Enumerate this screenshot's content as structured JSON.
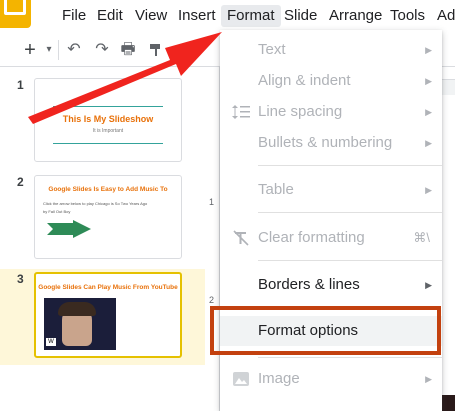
{
  "menubar": {
    "items": [
      "File",
      "Edit",
      "View",
      "Insert",
      "Format",
      "Slide",
      "Arrange",
      "Tools",
      "Ad"
    ],
    "active": "Format"
  },
  "toolbar": {
    "add": "+",
    "dropdown": "▾",
    "undo": "↶",
    "redo": "↷",
    "print": "🖶"
  },
  "filmstrip": {
    "slides": [
      {
        "number": "1",
        "title": "This Is My Slideshow",
        "subtitle": "It is Important"
      },
      {
        "number": "2",
        "title": "Google Slides Is Easy to Add Music To",
        "body1": "Click the arrow below to play Chicago is So Two Years Ago",
        "body2": "by Fall Out Boy"
      },
      {
        "number": "3",
        "title": "Google Slides Can Play Music From YouTube"
      }
    ]
  },
  "ruler": {
    "marks": [
      "1",
      "2"
    ]
  },
  "format_menu": {
    "items": [
      {
        "label": "Text",
        "enabled": false,
        "submenu": true
      },
      {
        "label": "Align & indent",
        "enabled": false,
        "submenu": true
      },
      {
        "label": "Line spacing",
        "enabled": false,
        "submenu": true,
        "icon": "line-spacing-icon"
      },
      {
        "label": "Bullets & numbering",
        "enabled": false,
        "submenu": true
      },
      {
        "label": "Table",
        "enabled": false,
        "submenu": true
      },
      {
        "label": "Clear formatting",
        "enabled": false,
        "shortcut": "⌘\\",
        "icon": "clear-formatting-icon"
      },
      {
        "label": "Borders & lines",
        "enabled": true,
        "submenu": true
      },
      {
        "label": "Format options",
        "enabled": true,
        "highlighted": true
      },
      {
        "label": "Image",
        "enabled": false,
        "submenu": true,
        "icon": "image-icon"
      }
    ]
  },
  "colors": {
    "accent_yellow": "#f4b400",
    "annotation_red": "#f0241e",
    "highlight_box": "#c3410f",
    "slide_title_orange": "#e8710a"
  }
}
